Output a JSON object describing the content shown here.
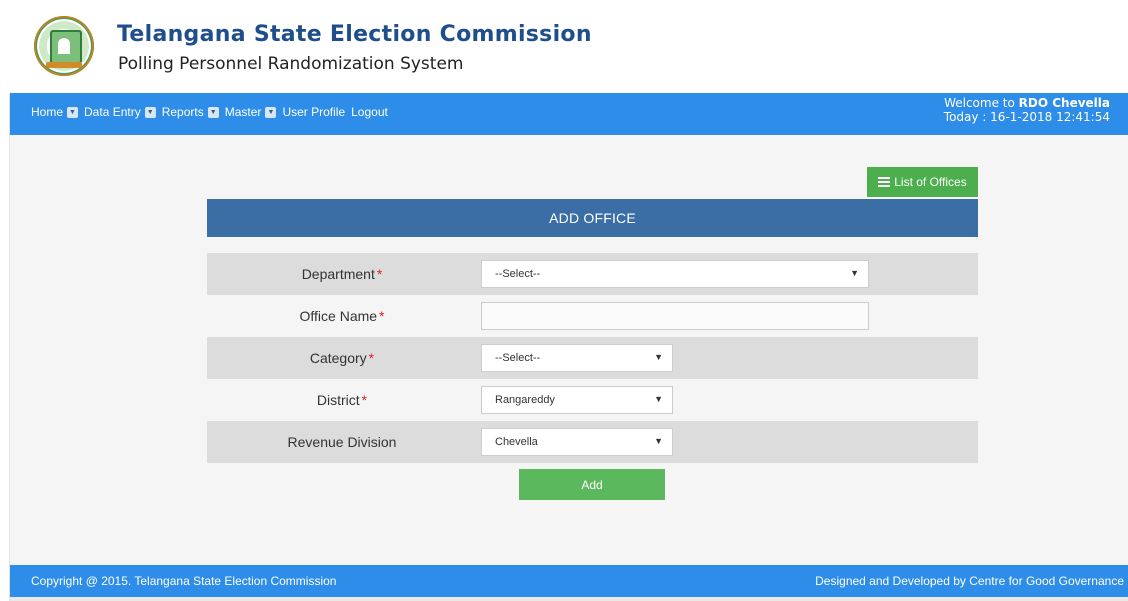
{
  "header": {
    "title": "Telangana State Election Commission",
    "subtitle": "Polling Personnel Randomization System"
  },
  "nav": {
    "items": [
      {
        "label": "Home",
        "dropdown": true
      },
      {
        "label": "Data Entry",
        "dropdown": true
      },
      {
        "label": "Reports",
        "dropdown": true
      },
      {
        "label": "Master",
        "dropdown": true
      },
      {
        "label": "User Profile",
        "dropdown": false
      },
      {
        "label": "Logout",
        "dropdown": false
      }
    ],
    "welcome_prefix": "Welcome to ",
    "welcome_user": "RDO Chevella",
    "today_line": "Today : 16-1-2018 12:41:54"
  },
  "actions": {
    "list_offices_label": "List of Offices",
    "list_icon": "list-icon",
    "add_label": "Add"
  },
  "form": {
    "heading": "ADD OFFICE",
    "required_marker": "*",
    "department_label": "Department ",
    "department_value": "--Select--",
    "office_name_label": "Office Name",
    "office_name_value": "",
    "category_label": "Category",
    "category_value": "--Select--",
    "district_label": "District",
    "district_value": "Rangareddy",
    "revenue_division_label": "Revenue Division",
    "revenue_division_value": "Chevella"
  },
  "footer": {
    "copyright": "Copyright @ 2015. Telangana State Election Commission",
    "credit": "Designed and Developed by Centre for Good Governance"
  },
  "colors": {
    "nav_bg": "#2d8de8",
    "panel_head_bg": "#3a6ea5",
    "button_green": "#5cb85c",
    "required_red": "#e02020",
    "title_blue": "#1f4e8c"
  }
}
